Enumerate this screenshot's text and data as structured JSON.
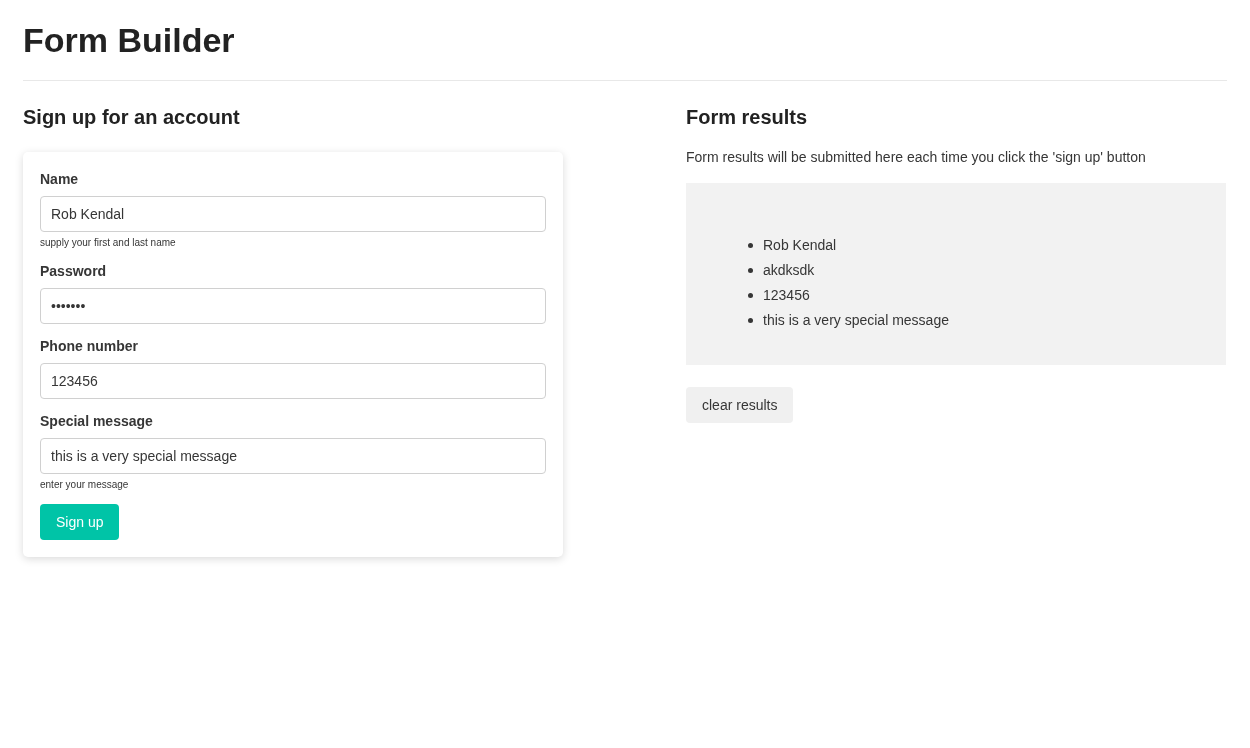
{
  "page_title": "Form Builder",
  "signup": {
    "heading": "Sign up for an account",
    "fields": [
      {
        "label": "Name",
        "value": "Rob Kendal",
        "help": "supply your first and last name"
      },
      {
        "label": "Password",
        "value": "•••••••"
      },
      {
        "label": "Phone number",
        "value": "123456"
      },
      {
        "label": "Special message",
        "value": "this is a very special message",
        "help": "enter your message"
      }
    ],
    "submit": "Sign up"
  },
  "results": {
    "heading": "Form results",
    "description": "Form results will be submitted here each time you click the 'sign up' button",
    "items": [
      "Rob Kendal",
      "akdksdk",
      "123456",
      "this is a very special message"
    ],
    "clear": "clear results"
  }
}
